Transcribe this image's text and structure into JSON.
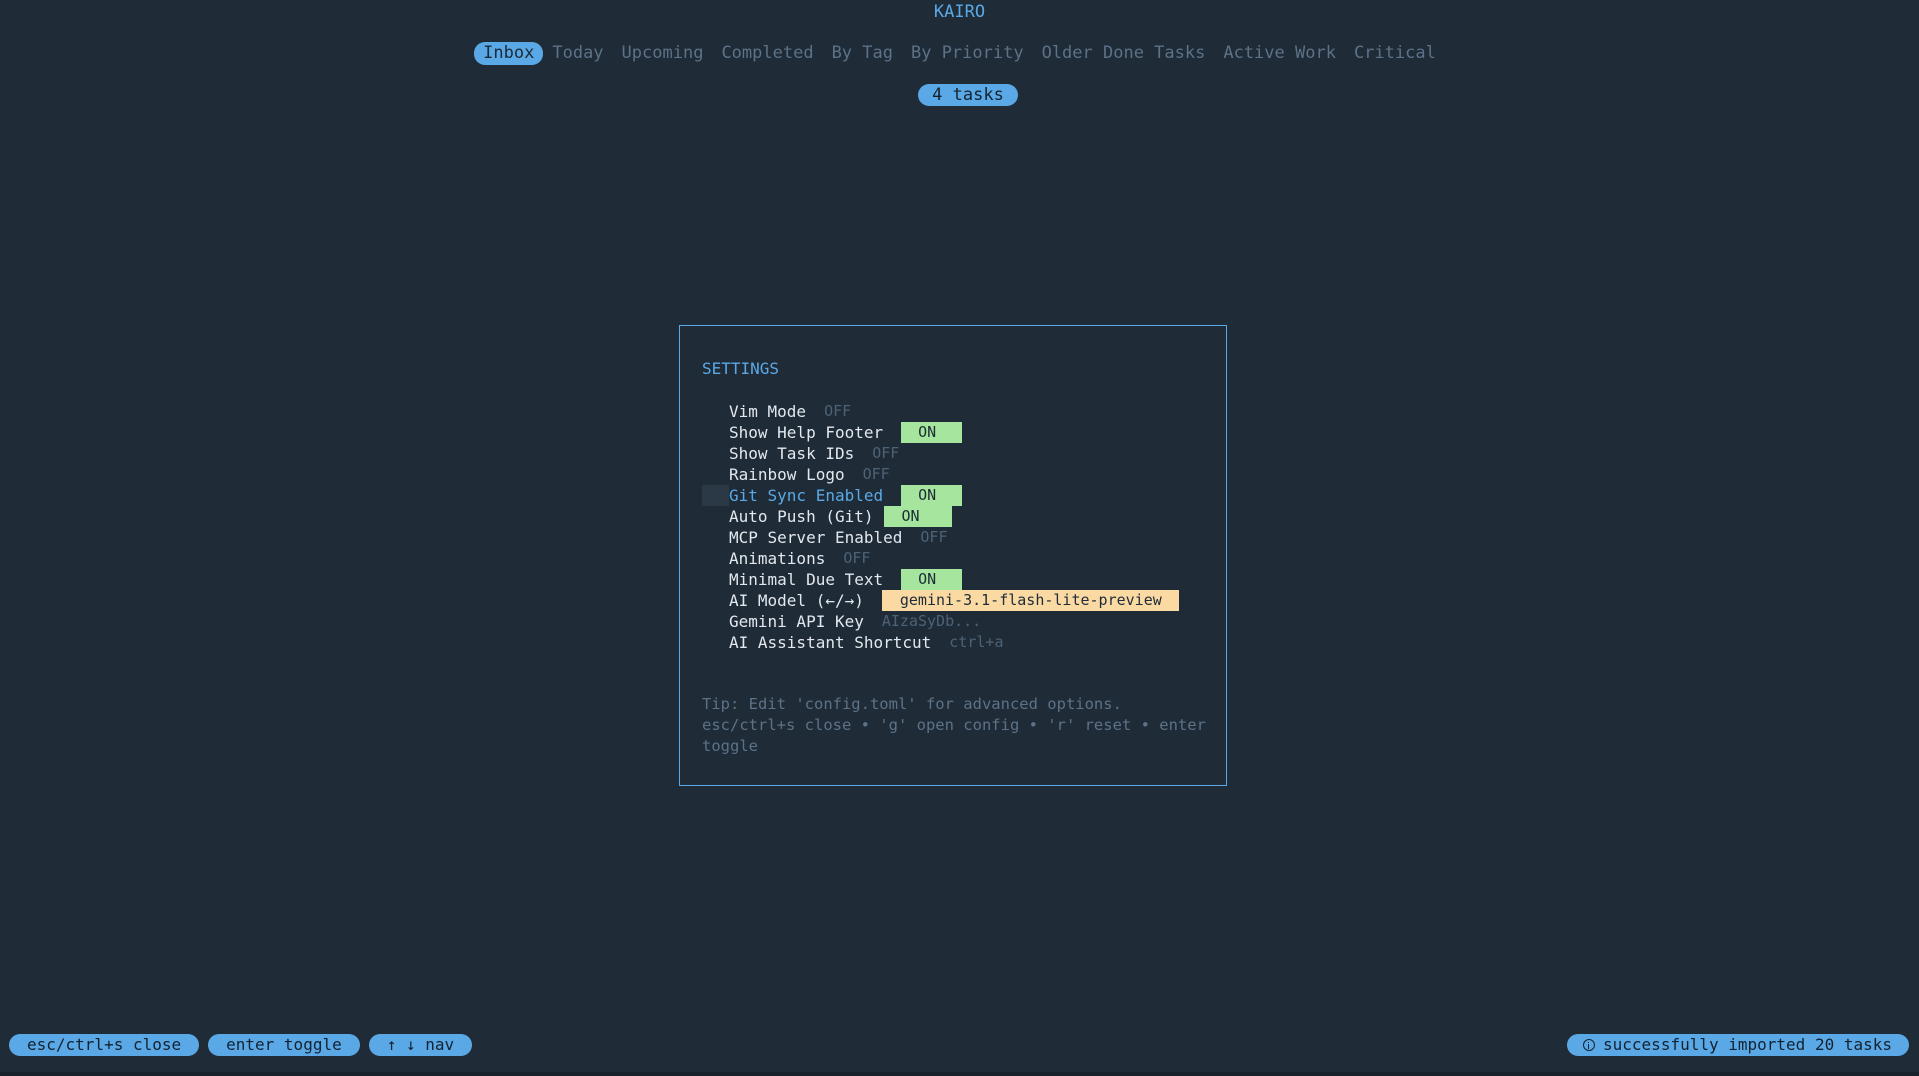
{
  "app": {
    "title": "KAIRO"
  },
  "tabs": [
    {
      "label": "Inbox",
      "active": true
    },
    {
      "label": "Today"
    },
    {
      "label": "Upcoming"
    },
    {
      "label": "Completed"
    },
    {
      "label": "By Tag"
    },
    {
      "label": "By Priority"
    },
    {
      "label": "Older Done Tasks"
    },
    {
      "label": "Active Work"
    },
    {
      "label": "Critical"
    }
  ],
  "task_count": "4 tasks",
  "settings": {
    "title": "SETTINGS",
    "items": [
      {
        "label": "Vim Mode",
        "value": "OFF"
      },
      {
        "label": "Show Help Footer",
        "value": "ON"
      },
      {
        "label": "Show Task IDs",
        "value": "OFF"
      },
      {
        "label": "Rainbow Logo",
        "value": "OFF"
      },
      {
        "label": "Git Sync Enabled",
        "value": "ON",
        "selected": true
      },
      {
        "label": "Auto Push (Git)",
        "value": "ON"
      },
      {
        "label": "MCP Server Enabled",
        "value": "OFF"
      },
      {
        "label": "Animations",
        "value": "OFF"
      },
      {
        "label": "Minimal Due Text",
        "value": "ON"
      },
      {
        "label": "AI Model (←/→)",
        "value": "gemini-3.1-flash-lite-preview"
      },
      {
        "label": "Gemini API Key",
        "value": "AIzaSyDb..."
      },
      {
        "label": "AI Assistant Shortcut",
        "value": "ctrl+a"
      }
    ],
    "tip_line1": "Tip: Edit 'config.toml' for advanced options.",
    "tip_line2": "esc/ctrl+s close • 'g' open config • 'r' reset • enter toggle"
  },
  "footer": {
    "keys": [
      "esc/ctrl+s close",
      "enter toggle",
      "↑ ↓  nav"
    ],
    "status": "successfully imported 20 tasks",
    "status_icon": "info-icon"
  },
  "colors": {
    "background": "#1f2b37",
    "accent": "#5aa9e6",
    "on": "#a6e59d",
    "model": "#fbd9a3",
    "muted": "#5d7287"
  }
}
